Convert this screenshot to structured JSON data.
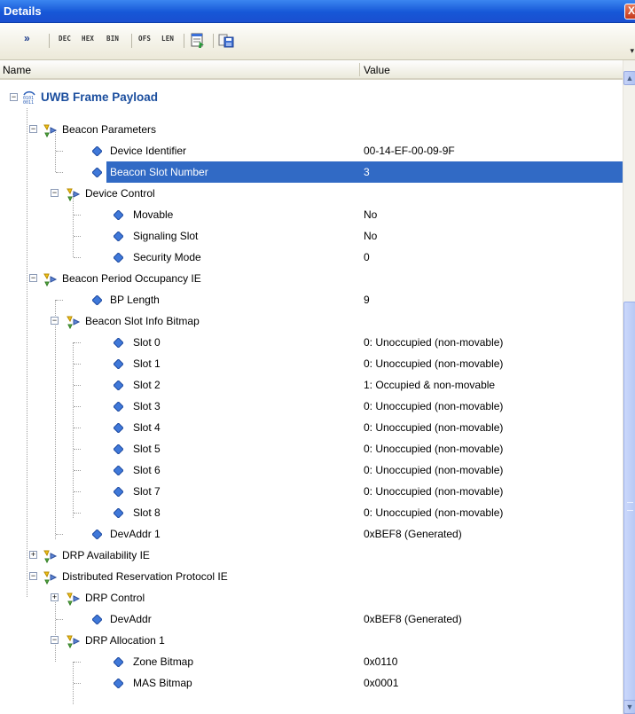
{
  "window": {
    "title": "Details",
    "close_label": "X"
  },
  "toolbar": {
    "chevron": "»",
    "dec_label": "DEC",
    "hex_label": "HEX",
    "bin_label": "BIN",
    "ofs_label": "OFS",
    "len_label": "LEN"
  },
  "columns": {
    "name": "Name",
    "value": "Value"
  },
  "tree": {
    "root_label": "UWB Frame Payload",
    "rows": [
      {
        "label": "Beacon Parameters",
        "value": ""
      },
      {
        "label": "Device Identifier",
        "value": "00-14-EF-00-09-9F"
      },
      {
        "label": "Beacon Slot Number",
        "value": "3"
      },
      {
        "label": "Device Control",
        "value": ""
      },
      {
        "label": "Movable",
        "value": "No"
      },
      {
        "label": "Signaling Slot",
        "value": "No"
      },
      {
        "label": "Security Mode",
        "value": "0"
      },
      {
        "label": "Beacon Period Occupancy IE",
        "value": ""
      },
      {
        "label": "BP Length",
        "value": "9"
      },
      {
        "label": "Beacon Slot Info Bitmap",
        "value": ""
      },
      {
        "label": "Slot 0",
        "value": "0: Unoccupied (non-movable)"
      },
      {
        "label": "Slot 1",
        "value": "0: Unoccupied (non-movable)"
      },
      {
        "label": "Slot 2",
        "value": "1: Occupied & non-movable"
      },
      {
        "label": "Slot 3",
        "value": "0: Unoccupied (non-movable)"
      },
      {
        "label": "Slot 4",
        "value": "0: Unoccupied (non-movable)"
      },
      {
        "label": "Slot 5",
        "value": "0: Unoccupied (non-movable)"
      },
      {
        "label": "Slot 6",
        "value": "0: Unoccupied (non-movable)"
      },
      {
        "label": "Slot 7",
        "value": "0: Unoccupied (non-movable)"
      },
      {
        "label": "Slot 8",
        "value": "0: Unoccupied (non-movable)"
      },
      {
        "label": "DevAddr 1",
        "value": "0xBEF8 (Generated)"
      },
      {
        "label": "DRP Availability IE",
        "value": ""
      },
      {
        "label": "Distributed Reservation Protocol IE",
        "value": ""
      },
      {
        "label": "DRP Control",
        "value": ""
      },
      {
        "label": "DevAddr",
        "value": "0xBEF8 (Generated)"
      },
      {
        "label": "DRP Allocation 1",
        "value": ""
      },
      {
        "label": "Zone Bitmap",
        "value": "0x0110"
      },
      {
        "label": "MAS Bitmap",
        "value": "0x0001"
      }
    ]
  },
  "icons": {
    "leaf": "field-diamond-icon",
    "group": "structure-group-icon",
    "root": "binary-payload-icon",
    "expanded": "collapse-toggle-icon",
    "collapsed": "expand-toggle-icon"
  },
  "colors": {
    "selection": "#316ac5",
    "titlebar": "#1657d7",
    "root_text": "#1b4e9e"
  }
}
